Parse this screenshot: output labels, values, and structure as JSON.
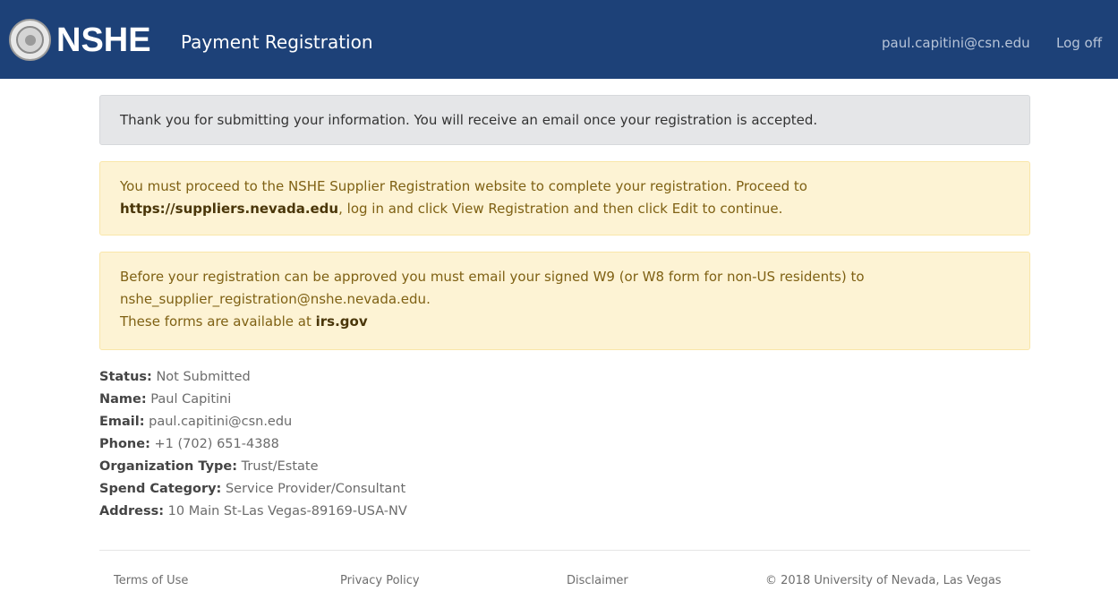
{
  "header": {
    "brand": "NSHE",
    "app_title": "Payment Registration",
    "user_email": "paul.capitini@csn.edu",
    "logoff_label": "Log off"
  },
  "alerts": {
    "submitted": "Thank you for submitting your information. You will receive an email once your registration is accepted.",
    "proceed": {
      "line1": "You must proceed to the NSHE Supplier Registration website to complete your registration. Proceed to",
      "link": "https://suppliers.nevada.edu",
      "line2_rest": ", log in and click View Registration and then click Edit to continue."
    },
    "w9": {
      "line1": "Before your registration can be approved you must email your signed W9 (or W8 form for non-US residents) to",
      "email": "nshe_supplier_registration@nshe.nevada.edu.",
      "line3_prefix": "These forms are available at ",
      "irs_link": "irs.gov"
    }
  },
  "details": [
    {
      "label": "Status:",
      "value": " Not Submitted"
    },
    {
      "label": "Name:",
      "value": " Paul Capitini"
    },
    {
      "label": "Email:",
      "value": " paul.capitini@csn.edu"
    },
    {
      "label": "Phone:",
      "value": " +1 (702) 651-4388"
    },
    {
      "label": "Organization Type:",
      "value": " Trust/Estate"
    },
    {
      "label": "Spend Category:",
      "value": " Service Provider/Consultant"
    },
    {
      "label": "Address:",
      "value": " 10 Main St-Las Vegas-89169-USA-NV"
    }
  ],
  "footer": {
    "terms": "Terms of Use",
    "privacy": "Privacy Policy",
    "disclaimer": "Disclaimer",
    "copyright": "© 2018 University of Nevada, Las Vegas"
  },
  "colors": {
    "navbar": "#1d4178",
    "alert_info_bg": "#e5e6e8",
    "alert_warning_bg": "#fdf3d4"
  }
}
